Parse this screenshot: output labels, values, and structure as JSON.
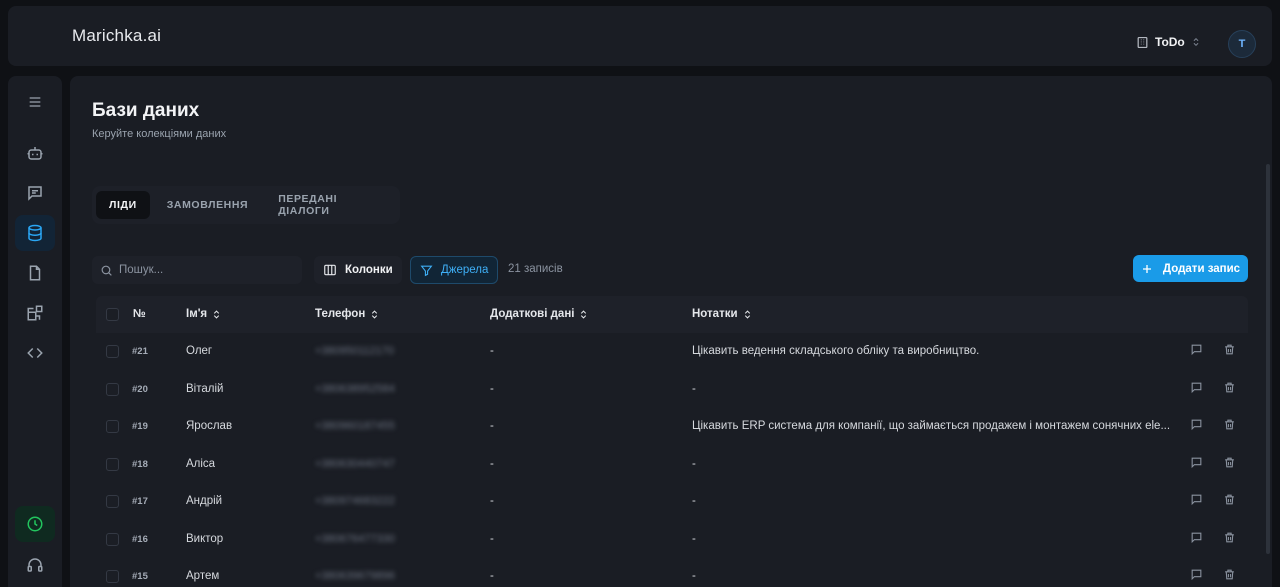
{
  "app": {
    "brand": "Marichka.ai"
  },
  "workspace": {
    "name": "ToDo",
    "avatar_letter": "T"
  },
  "page": {
    "title": "Бази даних",
    "subtitle": "Керуйте колекціями даних"
  },
  "tabs": [
    {
      "label": "ЛІДИ",
      "active": true
    },
    {
      "label": "ЗАМОВЛЕННЯ",
      "active": false
    },
    {
      "label": "ПЕРЕДАНІ ДІАЛОГИ",
      "active": false
    }
  ],
  "toolbar": {
    "search_placeholder": "Пошук...",
    "columns_label": "Колонки",
    "sources_label": "Джерела",
    "records_count": "21 записів",
    "add_label": "Додати запис"
  },
  "table": {
    "headers": {
      "num": "№",
      "name": "Ім'я",
      "phone": "Телефон",
      "extra": "Додаткові дані",
      "notes": "Нотатки"
    },
    "rows": [
      {
        "num": "#21",
        "name": "Олег",
        "phone": "+380950112170",
        "extra": "-",
        "notes": "Цікавить ведення складського обліку та виробництво."
      },
      {
        "num": "#20",
        "name": "Віталій",
        "phone": "+380638952584",
        "extra": "-",
        "notes": "-"
      },
      {
        "num": "#19",
        "name": "Ярослав",
        "phone": "+380960187455",
        "extra": "-",
        "notes": "Цікавить ERP система для компанії, що займається продажем і монтажем сонячних ele..."
      },
      {
        "num": "#18",
        "name": "Аліса",
        "phone": "+380630440747",
        "extra": "-",
        "notes": "-"
      },
      {
        "num": "#17",
        "name": "Андрій",
        "phone": "+380974683222",
        "extra": "-",
        "notes": "-"
      },
      {
        "num": "#16",
        "name": "Виктор",
        "phone": "+380676477330",
        "extra": "-",
        "notes": "-"
      },
      {
        "num": "#15",
        "name": "Артем",
        "phone": "+380639679896",
        "extra": "-",
        "notes": "-"
      }
    ]
  },
  "colors": {
    "accent": "#1a9be8",
    "background": "#0f1115",
    "panel": "#1a1d24",
    "success": "#22c55e"
  }
}
